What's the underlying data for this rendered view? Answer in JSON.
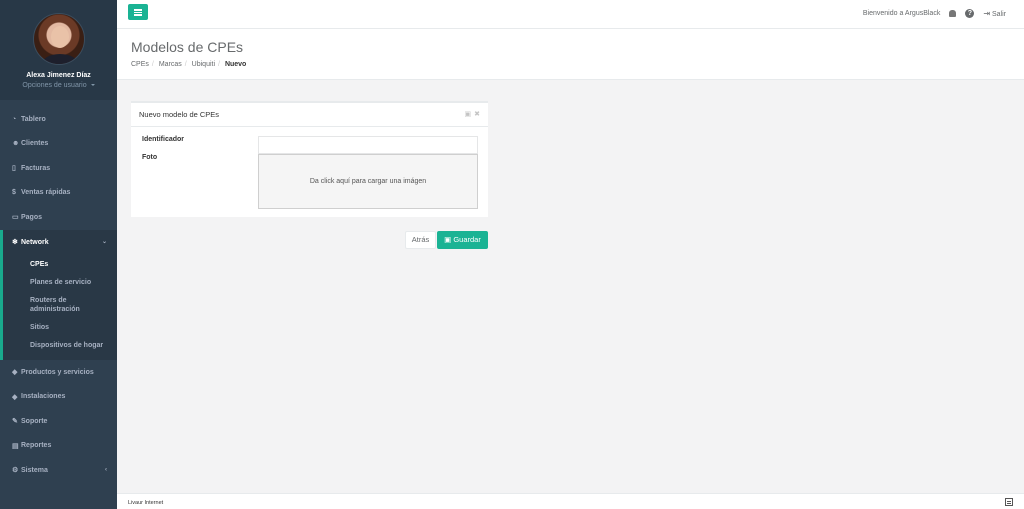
{
  "user": {
    "name": "Alexa Jimenez Díaz",
    "options": "Opciones de usuario"
  },
  "menu": [
    {
      "icon": "tachometer-icon",
      "glyph": "◔",
      "label": "Tablero"
    },
    {
      "icon": "users-icon",
      "glyph": "☻",
      "label": "Clientes"
    },
    {
      "icon": "file-icon",
      "glyph": "▯",
      "label": "Facturas"
    },
    {
      "icon": "dollar-icon",
      "glyph": "$",
      "label": "Ventas rápidas"
    },
    {
      "icon": "money-icon",
      "glyph": "▭",
      "label": "Pagos"
    }
  ],
  "network": {
    "label": "Network",
    "glyph": "❄",
    "arrow": "⌄",
    "items": [
      "CPEs",
      "Planes de servicio",
      "Routers de administración",
      "Sitios",
      "Dispositivos de hogar"
    ]
  },
  "menu2": [
    {
      "icon": "tag-icon",
      "glyph": "◆",
      "label": "Productos y servicios"
    },
    {
      "icon": "tools-icon",
      "glyph": "◆",
      "label": "Instalaciones"
    },
    {
      "icon": "wrench-icon",
      "glyph": "✎",
      "label": "Soporte"
    },
    {
      "icon": "book-icon",
      "glyph": "▤",
      "label": "Reportes"
    },
    {
      "icon": "cogs-icon",
      "glyph": "⚙",
      "label": "Sistema",
      "arrow": "‹"
    }
  ],
  "topbar": {
    "welcome": "Bienvenido a ArgusBlack",
    "help": "?",
    "logout_glyph": "⇥",
    "logout": "Salir"
  },
  "page": {
    "title": "Modelos de CPEs",
    "breadcrumb": [
      "CPEs",
      "Marcas",
      "Ubiquiti",
      "Nuevo"
    ]
  },
  "card": {
    "title": "Nuevo modelo de CPEs",
    "tool_save": "▣",
    "tool_close": "✖",
    "identifier_label": "Identificador",
    "identifier_value": "",
    "photo_label": "Foto",
    "dropzone_text": "Da click aquí para cargar una imágen"
  },
  "buttons": {
    "back": "Atrás",
    "save_glyph": "▣",
    "save": "Guardar"
  },
  "footer": {
    "text": "Livaur Internet"
  },
  "colors": {
    "sidebar": "#2f4050",
    "accent": "#1ab394"
  }
}
